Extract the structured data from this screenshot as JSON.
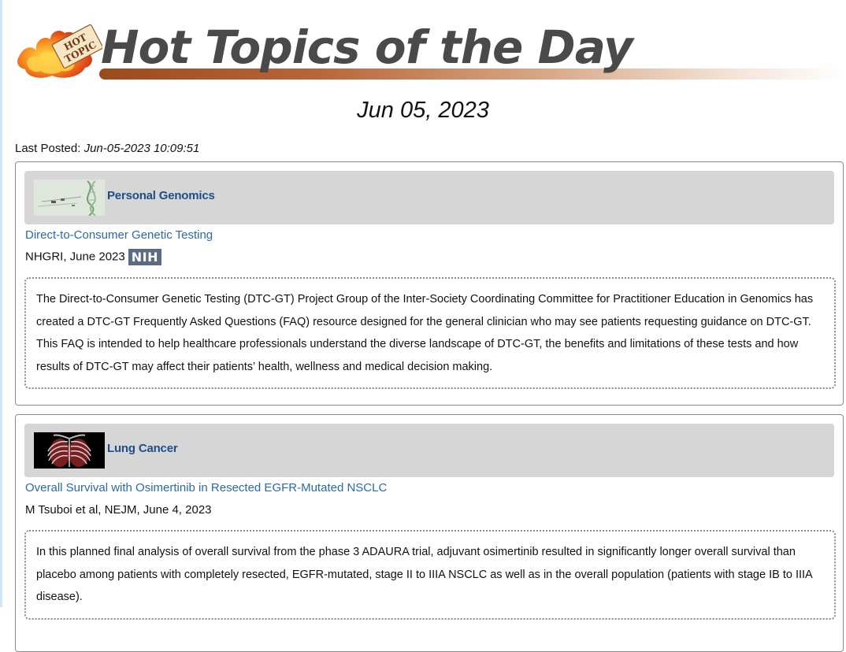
{
  "header": {
    "logo_text_top": "HOT",
    "logo_text_bottom": "TOPIC",
    "title": "Hot Topics of the Day",
    "colors": {
      "title": "#4a4a4a",
      "bar_start": "#9b4a1c",
      "bar_end": "#ffffff"
    }
  },
  "date": "Jun 05, 2023",
  "last_posted": {
    "label": "Last Posted:",
    "value": "Jun-05-2023 10:09:51"
  },
  "topics": [
    {
      "category": "Personal Genomics",
      "thumbnail_icon": "dna-thumbnail",
      "article_title": "Direct-to-Consumer Genetic Testing",
      "source": "NHGRI, June 2023",
      "badge": "NIH",
      "summary": "The Direct-to-Consumer Genetic Testing (DTC-GT) Project Group of the Inter-Society Coordinating Committee for Practitioner Education in Genomics has created a DTC-GT Frequently Asked Questions (FAQ) resource designed for the general clinician who may see patients requesting guidance on DTC-GT. This FAQ is intended to help healthcare professionals understand the diverse landscape of DTC-GT, the benefits and limitations of these tests and how results of DTC-GT may affect their patients’ health, wellness and medical decision making."
    },
    {
      "category": "Lung Cancer",
      "thumbnail_icon": "lung-xray-thumbnail",
      "article_title": "Overall Survival with Osimertinib in Resected EGFR-Mutated NSCLC",
      "source": "M Tsuboi et al, NEJM, June 4, 2023",
      "summary": "In this planned final analysis of overall survival from the phase 3 ADAURA trial, adjuvant osimertinib resulted in significantly longer overall survival than placebo among patients with completely resected, EGFR-mutated, stage II to IIIA NSCLC as well as in the overall population (patients with stage IB to IIIA disease)."
    }
  ]
}
